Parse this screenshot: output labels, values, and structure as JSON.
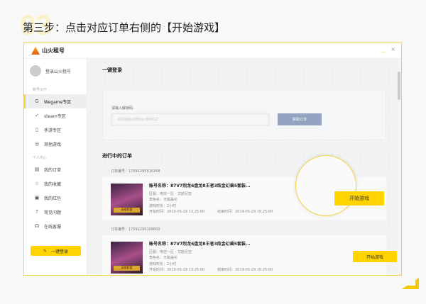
{
  "step_number": "03",
  "title": "第三步：点击对应订单右侧的【开始游戏】",
  "app": {
    "name": "山火租号",
    "minimize": "_",
    "close": "×"
  },
  "sidebar": {
    "login_text": "登录山火租号",
    "section1": "账号大厅",
    "items1": [
      {
        "icon": "G",
        "label": "Wegame专区"
      },
      {
        "icon": "✓",
        "label": "steam专区"
      },
      {
        "icon": "▯",
        "label": "手游专区"
      },
      {
        "icon": "◎",
        "label": "其他游戏"
      }
    ],
    "section2": "个人中心",
    "items2": [
      {
        "icon": "▤",
        "label": "我的订单"
      },
      {
        "icon": "☆",
        "label": "我的收藏"
      },
      {
        "icon": "▣",
        "label": "我的红包"
      },
      {
        "icon": "?",
        "label": "常见问题"
      },
      {
        "icon": "☊",
        "label": "在线客服"
      }
    ],
    "login_button": "一键登录",
    "login_icon": "✎"
  },
  "main": {
    "heading": "一键登录",
    "code_label": "请输入解锁码:",
    "code_value": "A51bKb-DPHLk-RNH1Z",
    "get_order": "获取订单",
    "orders_heading": "进行中的订单",
    "orders": [
      {
        "order_no": "订单编号：17591295510258",
        "name": "账号名称：87V7烈龙6盘龙8王者3炫金幻兽5套装...",
        "server": "区服：电信一区 - 艾欧尼亚",
        "role": "角色名：无敌盖伦",
        "duration": "游戏时长：2小时",
        "start": "开始时间：2019-05-29 13:25:00",
        "end": "结束时间：2019-05-29 15:25:00",
        "button": "开始游戏",
        "thumb_text": "英雄联盟"
      },
      {
        "order_no": "订单编号：17591295109600",
        "name": "账号名称：87V7烈龙6盘龙8王者3炫金幻兽5套装...",
        "server": "区服：电信一区 - 艾欧尼亚",
        "role": "角色名：无敌盖伦",
        "duration": "游戏时长：2小时",
        "start": "开始时间：2019-05-29 13:25:00",
        "end": "结束时间：2019-05-29 15:25:00",
        "button": "开始游戏",
        "thumb_text": "英雄联盟"
      }
    ]
  },
  "colors": {
    "accent": "#ffd400",
    "frame": "#f5d33a",
    "button_gray": "#94a3c0"
  }
}
